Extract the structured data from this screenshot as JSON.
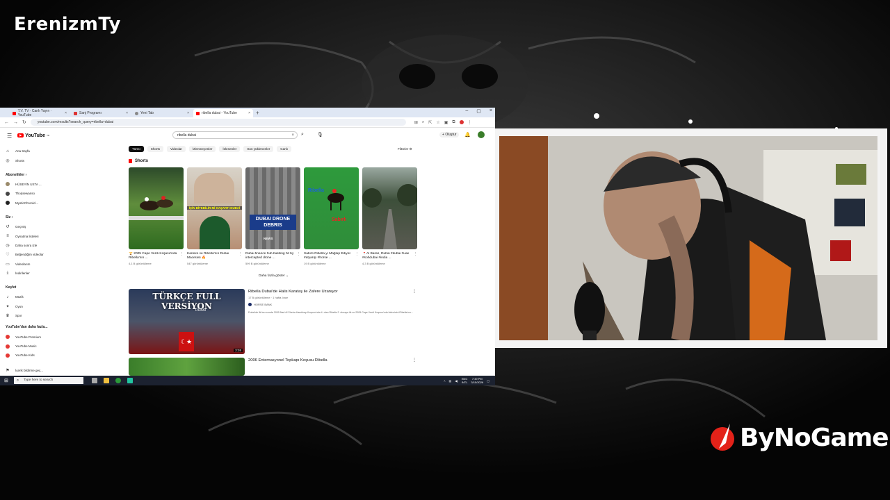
{
  "overlay": {
    "channel_name": "ErenizmTy",
    "sponsor": "ByNoGame"
  },
  "browser": {
    "tabs": [
      {
        "label": "T.V. TV · Canlı Yayın · YouTube",
        "favicon": "youtube-icon"
      },
      {
        "label": "Sanj Programı",
        "favicon": "bookmark-icon"
      },
      {
        "label": "Yeni Tab",
        "favicon": "globe-icon"
      },
      {
        "label": "ribella dubai - YouTube",
        "favicon": "youtube-icon",
        "active": true
      }
    ],
    "url": "youtube.com/results?search_query=ribella+dubai"
  },
  "youtube": {
    "logo": "YouTube",
    "logo_sup": "TR",
    "search_query": "ribella dubai",
    "create_label": "Oluştur",
    "sidebar": {
      "main": [
        {
          "label": "Ana Sayfa",
          "icon": "home-icon"
        },
        {
          "label": "Shorts",
          "icon": "shorts-icon"
        }
      ],
      "subs_heading": "Abonelikler",
      "subs": [
        {
          "label": "HÜSEYİN USTA ...",
          "color": "#9a8a6a"
        },
        {
          "label": "Thorjsewanso",
          "color": "#444444"
        },
        {
          "label": "MysticChronicl...",
          "color": "#222222"
        }
      ],
      "you_heading": "Siz",
      "you": [
        {
          "label": "Geçmiş",
          "icon": "history-icon"
        },
        {
          "label": "Oynatma listeleri",
          "icon": "playlist-icon"
        },
        {
          "label": "Daha sonra izle",
          "icon": "clock-icon"
        },
        {
          "label": "Beğendiğim videolar",
          "icon": "like-icon"
        },
        {
          "label": "Videolarım",
          "icon": "video-icon"
        },
        {
          "label": "İndirilenler",
          "icon": "download-icon"
        }
      ],
      "explore_heading": "Keşfet",
      "explore": [
        {
          "label": "Müzik",
          "icon": "music-icon"
        },
        {
          "label": "Oyun",
          "icon": "gamepad-icon"
        },
        {
          "label": "Spor",
          "icon": "trophy-icon"
        }
      ],
      "more_heading": "YouTube'dan daha fazla...",
      "more": [
        {
          "label": "YouTube Premium",
          "color": "#e53935"
        },
        {
          "label": "YouTube Music",
          "color": "#e53935"
        },
        {
          "label": "YouTube Kids",
          "color": "#e53935"
        }
      ],
      "footer": "İçerik bildirme geç..."
    },
    "chips": [
      "Tümü",
      "Shorts",
      "Videolar",
      "İzlenmeyenler",
      "İzlenenler",
      "Son yüklenenler",
      "Canlı"
    ],
    "filters_label": "Filtreler",
    "shorts_heading": "Shorts",
    "shorts": [
      {
        "title": "🏆 2005 Cape Verdi Koşusu'nda Ribella'nın ...",
        "views": "4,1 B görüntüleme"
      },
      {
        "title": "Kaneko ve Ribella'nın Dubai Macerası 🔥",
        "views": "547 görüntüleme",
        "overlay_text": "İÇİN BİTEBİLİR Mİ KAŞARTI DUBAİ"
      },
      {
        "title": "Dubai finance hub building hit by intercepted drone ...",
        "views": "599 B görüntüleme",
        "overlay_text": "DUBAI DRONE DEBRIS",
        "badge": "NEWS"
      },
      {
        "title": "Sabırlı Ribella yı Mağlup Ediyor. #atyarışı #horse ...",
        "views": "19 B görüntüleme",
        "overlay_text_1": "Ribella",
        "overlay_text_2": "Sabırlı"
      },
      {
        "title": "📍Al Barari, Dubai #dubai #uae #sohdubai #india ...",
        "views": "4,3 B görüntüleme"
      }
    ],
    "more_label": "Daha fazla göster",
    "videos": [
      {
        "title": "Ribella Dubai'de Halis Karataş ile Zafere Uzanıyor",
        "meta": "17 B görüntüleme · 1 hafta önce",
        "channel": "HORSE BANK",
        "desc": "Dubai'de ilk kez sonda 2005 Nad Al Sheba Handicap Koşusu'nda 4. olan Ribella 2. olmaya ilk ve 2005 Cape Verdi Koşusu'nda birincisini Ribella'nın...",
        "thumb_text": "TÜRKÇE FULL VERSİYON",
        "thumb_label": "DUBAI",
        "duration": "2:26"
      },
      {
        "title": "2006 Enternasyonel Topkapı Koşusu Ribella",
        "meta": "",
        "channel": "",
        "desc": ""
      }
    ]
  },
  "taskbar": {
    "search_placeholder": "Type here to search",
    "language": "ENG",
    "region": "INTL",
    "time": "7:49 PM",
    "date": "3/15/2026"
  }
}
